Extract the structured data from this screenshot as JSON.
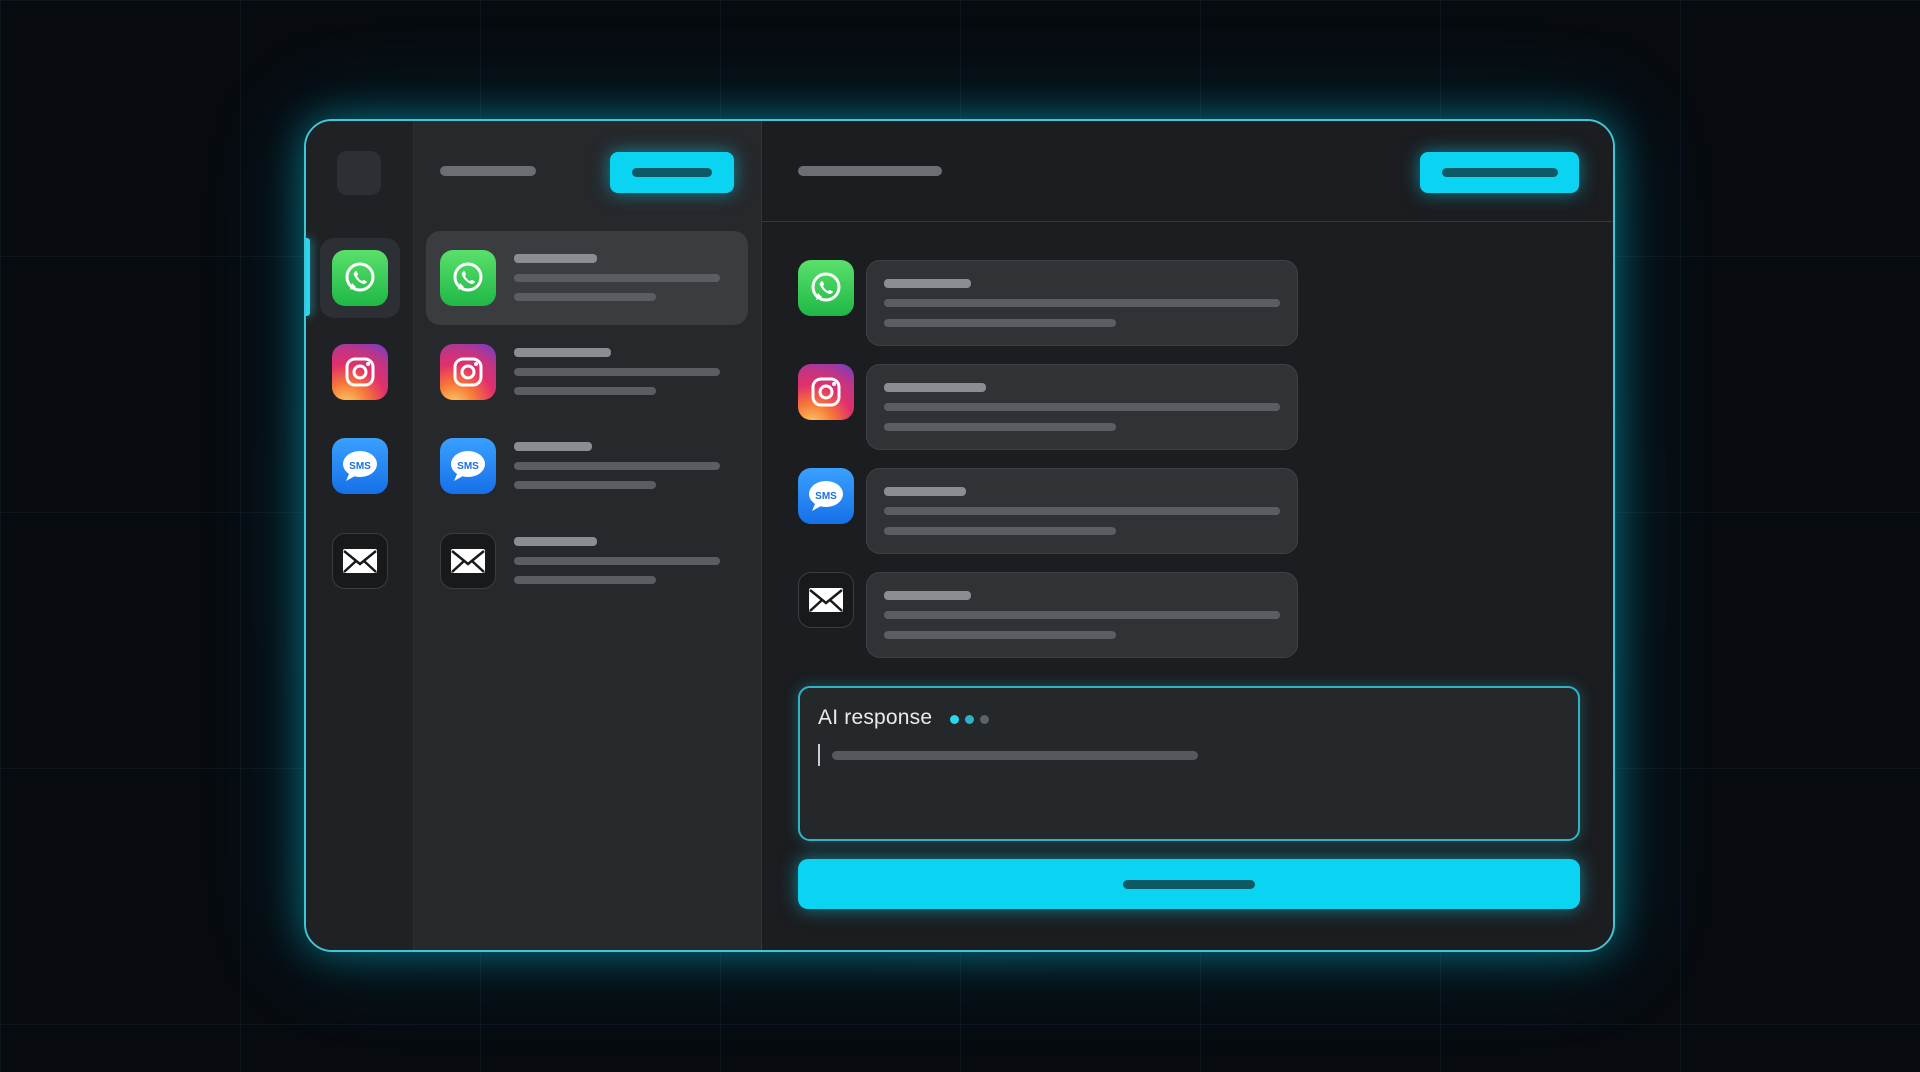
{
  "rail": {
    "items": [
      {
        "app": "whatsapp",
        "icon": "whatsapp-icon",
        "active": true
      },
      {
        "app": "instagram",
        "icon": "instagram-icon",
        "active": false
      },
      {
        "app": "sms",
        "icon": "sms-icon",
        "active": false
      },
      {
        "app": "mail",
        "icon": "mail-icon",
        "active": false
      }
    ]
  },
  "icons": {
    "sms_label": "SMS"
  },
  "conversations": [
    {
      "app": "whatsapp",
      "selected": true
    },
    {
      "app": "instagram",
      "selected": false
    },
    {
      "app": "sms",
      "selected": false
    },
    {
      "app": "mail",
      "selected": false
    }
  ],
  "messages": [
    {
      "app": "whatsapp"
    },
    {
      "app": "instagram"
    },
    {
      "app": "sms"
    },
    {
      "app": "mail"
    }
  ],
  "ai_response": {
    "label": "AI response",
    "dots": [
      "#2ad6ee",
      "#2ab3c8",
      "#5c6268"
    ]
  },
  "colors": {
    "accent": "#0bd3f2",
    "window_border": "#3fc6d8",
    "background": "#070b10"
  }
}
